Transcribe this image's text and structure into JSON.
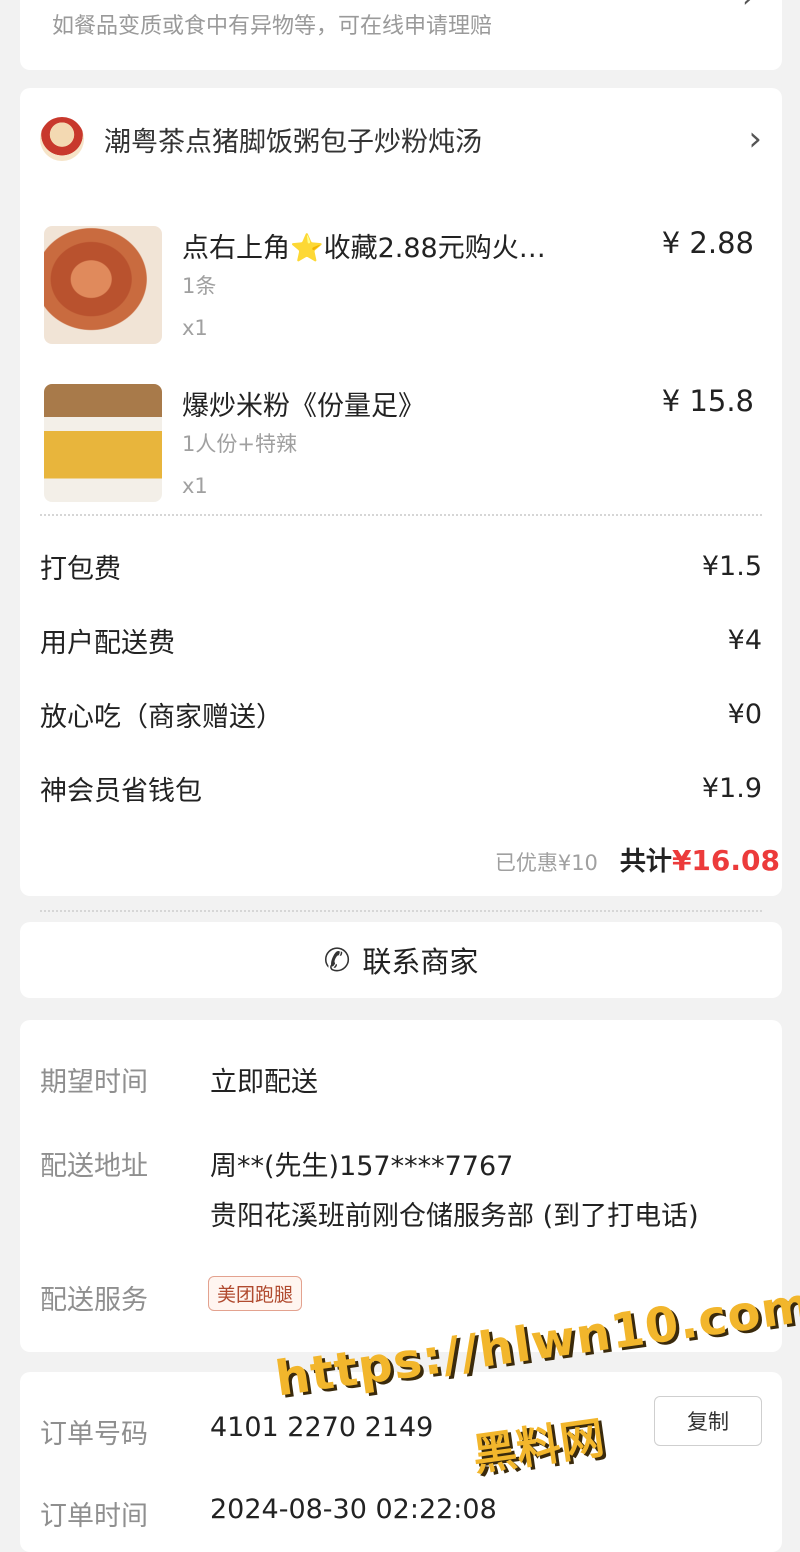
{
  "notice": {
    "text": "如餐品变质或食中有异物等，可在线申请理赔"
  },
  "shop": {
    "name": "潮粤茶点猪脚饭粥包子炒粉炖汤"
  },
  "items": [
    {
      "name": "点右上角⭐收藏2.88元购火…",
      "spec": "1条",
      "qty": "x1",
      "price": "¥ 2.88"
    },
    {
      "name": "爆炒米粉《份量足》",
      "spec": "1人份+特辣",
      "qty": "x1",
      "price": "¥ 15.8"
    }
  ],
  "fees": [
    {
      "label": "打包费",
      "value": "¥1.5"
    },
    {
      "label": "用户配送费",
      "value": "¥4"
    },
    {
      "label": "放心吃（商家赠送）",
      "value": "¥0"
    },
    {
      "label": "神会员省钱包",
      "value": "¥1.9"
    }
  ],
  "summary": {
    "discount": "已优惠¥10",
    "total_label": "共计",
    "total_value": "¥16.08"
  },
  "contact": {
    "label": "联系商家",
    "icon": "phone-icon"
  },
  "delivery": {
    "time_label": "期望时间",
    "time_value": "立即配送",
    "address_label": "配送地址",
    "address_line1": "周**(先生)157****7767",
    "address_line2": "贵阳花溪班前刚仓储服务部 (到了打电话)",
    "service_label": "配送服务",
    "service_badge": "美团跑腿"
  },
  "order_info": {
    "number_label": "订单号码",
    "number_value": "4101 2270 2149 ",
    "copy_label": "复制",
    "time_label": "订单时间",
    "time_value": "2024-08-30 02:22:08"
  },
  "watermark": {
    "url": "https://hlwn10.com",
    "name": "黑料网"
  }
}
